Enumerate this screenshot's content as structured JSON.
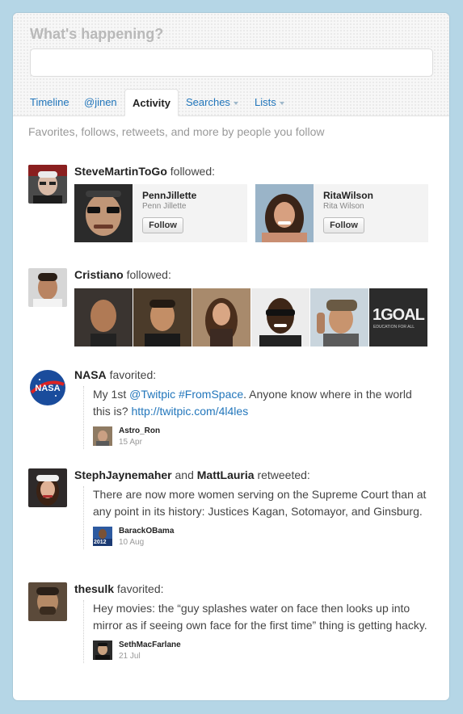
{
  "compose": {
    "heading": "What's happening?"
  },
  "tabs": [
    {
      "label": "Timeline"
    },
    {
      "label": "@jinen"
    },
    {
      "label": "Activity"
    },
    {
      "label": "Searches"
    },
    {
      "label": "Lists"
    }
  ],
  "subtitle": "Favorites, follows, retweets, and more by people you follow",
  "activity": {
    "steve": {
      "user": "SteveMartinToGo",
      "action": "followed:",
      "follows": [
        {
          "screen_name": "PennJillette",
          "full_name": "Penn Jillette",
          "button": "Follow"
        },
        {
          "screen_name": "RitaWilson",
          "full_name": "Rita Wilson",
          "button": "Follow"
        }
      ]
    },
    "cristiano": {
      "user": "Cristiano",
      "action": "followed:",
      "thumb_text": "1GOAL",
      "thumb_subtext": "EDUCATION FOR ALL"
    },
    "nasa": {
      "user": "NASA",
      "action": "favorited:",
      "avatar_text": "NASA",
      "tweet_pre": "My 1st ",
      "tweet_mention": "@Twitpic",
      "tweet_space": " ",
      "tweet_hashtag": "#FromSpace",
      "tweet_mid": ". Anyone know where in the world this is? ",
      "tweet_link": "http://twitpic.com/4l4les",
      "author": "Astro_Ron",
      "date": "15 Apr"
    },
    "steph": {
      "user1": "StephJaynemaher",
      "conj": "and",
      "user2": "MattLauria",
      "action": "retweeted:",
      "tweet": "There are now more women serving on the Supreme Court than at any point in its history: Justices Kagan, Sotomayor, and Ginsburg.",
      "author": "BarackOBama",
      "author_badge": "2012",
      "date": "10 Aug"
    },
    "thesulk": {
      "user": "thesulk",
      "action": "favorited:",
      "tweet": "Hey movies: the “guy splashes water on face then looks up into mirror as if seeing own face for the first time” thing is getting hacky.",
      "author": "SethMacFarlane",
      "date": "21 Jul"
    }
  }
}
